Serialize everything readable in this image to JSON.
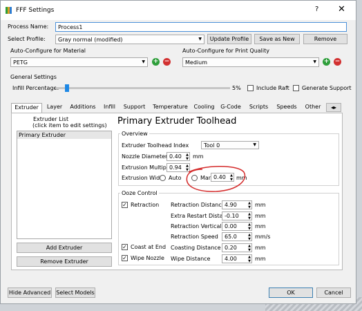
{
  "window": {
    "title": "FFF Settings",
    "help_icon": "?",
    "close_icon": "✕"
  },
  "process_name": {
    "label": "Process Name:",
    "value": "Process1"
  },
  "profile": {
    "label": "Select Profile:",
    "value": "Gray normal (modified)",
    "update": "Update Profile",
    "save_as_new": "Save as New",
    "remove": "Remove"
  },
  "auto_material": {
    "label": "Auto-Configure for Material",
    "value": "PETG"
  },
  "auto_quality": {
    "label": "Auto-Configure for Print Quality",
    "value": "Medium"
  },
  "general": {
    "label": "General Settings",
    "infill_label": "Infill Percentage:",
    "infill_value": "5%",
    "infill_fraction": 0.05,
    "include_raft": "Include Raft",
    "generate_support": "Generate Support"
  },
  "tabs": [
    "Extruder",
    "Layer",
    "Additions",
    "Infill",
    "Support",
    "Temperature",
    "Cooling",
    "G-Code",
    "Scripts",
    "Speeds",
    "Other"
  ],
  "extruder_list": {
    "title1": "Extruder List",
    "title2": "(click item to edit settings)",
    "items": [
      "Primary Extruder"
    ],
    "add": "Add Extruder",
    "remove": "Remove Extruder"
  },
  "heading": "Primary Extruder Toolhead",
  "overview": {
    "label": "Overview",
    "toolhead_label": "Extruder Toolhead Index",
    "toolhead_value": "Tool 0",
    "nozzle_label": "Nozzle Diameter",
    "nozzle_value": "0.40",
    "nozzle_unit": "mm",
    "mult_label": "Extrusion Multiplier",
    "mult_value": "0.94",
    "width_label": "Extrusion Width",
    "auto": "Auto",
    "manual": "Manual",
    "width_value": "0.40",
    "width_unit": "mm"
  },
  "ooze": {
    "label": "Ooze Control",
    "retraction": "Retraction",
    "retraction_distance_label": "Retraction Distance",
    "retraction_distance": "4.90",
    "extra_restart_label": "Extra Restart Distance",
    "extra_restart": "-0.10",
    "vertical_lift_label": "Retraction Vertical Lift",
    "vertical_lift": "0.00",
    "retraction_speed_label": "Retraction Speed",
    "retraction_speed": "65.0",
    "coast_label": "Coast at End",
    "coasting_distance_label": "Coasting Distance",
    "coasting_distance": "0.20",
    "wipe_label": "Wipe Nozzle",
    "wipe_distance_label": "Wipe Distance",
    "wipe_distance": "4.00",
    "mm": "mm",
    "mms": "mm/s"
  },
  "footer": {
    "hide_advanced": "Hide Advanced",
    "select_models": "Select Models",
    "ok": "OK",
    "cancel": "Cancel"
  },
  "colors": {
    "annotation": "#d42a2a",
    "slider_handle": "#1e88e5"
  }
}
